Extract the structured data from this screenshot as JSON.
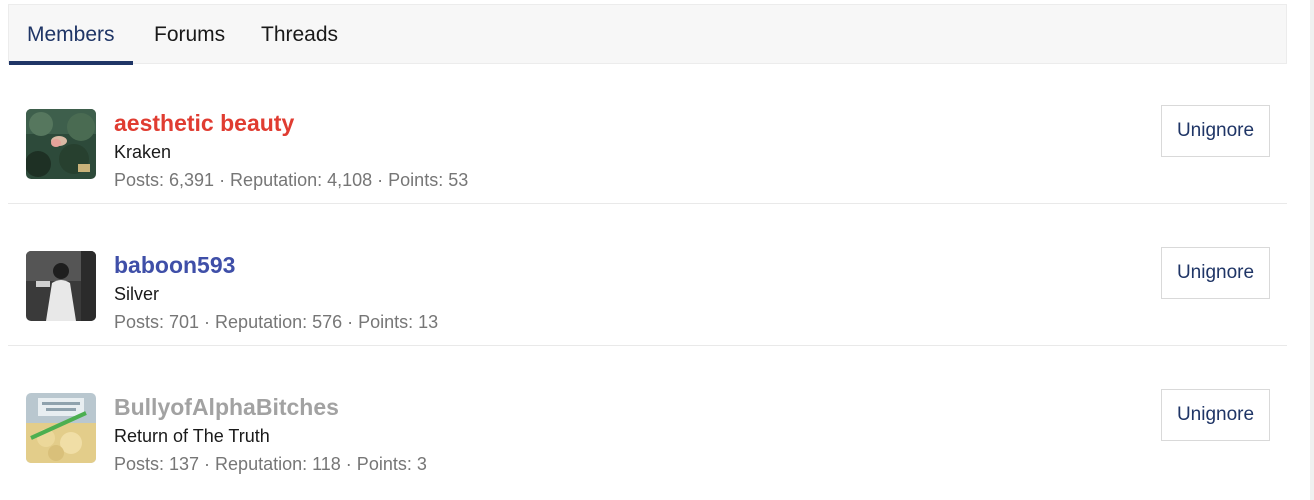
{
  "tabs": [
    {
      "label": "Members",
      "active": true
    },
    {
      "label": "Forums",
      "active": false
    },
    {
      "label": "Threads",
      "active": false
    }
  ],
  "members": [
    {
      "username": "aesthetic beauty",
      "username_color": "#e03c31",
      "title": "Kraken",
      "stats": "Posts: 6,391 · Reputation: 4,108 · Points: 53",
      "button": "Unignore"
    },
    {
      "username": "baboon593",
      "username_color": "#3f4fa8",
      "title": "Silver",
      "stats": "Posts: 701 · Reputation: 576 · Points: 13",
      "button": "Unignore"
    },
    {
      "username": "BullyofAlphaBitches",
      "username_color": "#a2a2a2",
      "title": "Return of The Truth",
      "stats": "Posts: 137 · Reputation: 118 · Points: 3",
      "button": "Unignore"
    }
  ],
  "colors": {
    "accent": "#1f3566",
    "tab_bar_bg": "#f7f7f7",
    "stats_text": "#767676"
  }
}
